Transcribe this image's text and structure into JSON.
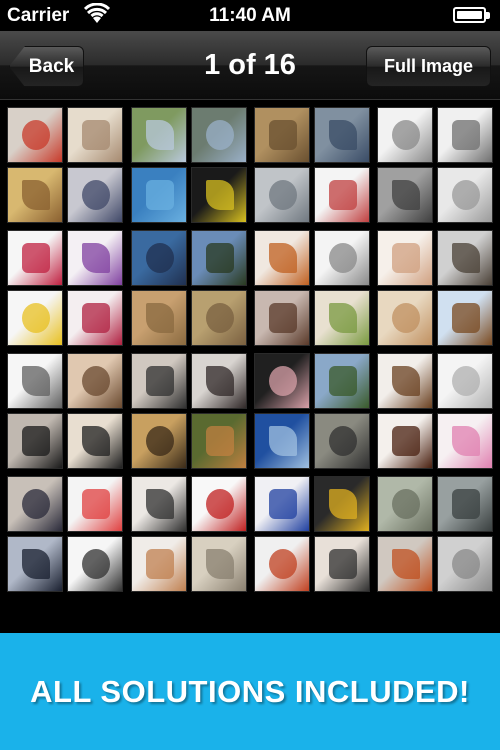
{
  "status_bar": {
    "carrier": "Carrier",
    "time": "11:40 AM",
    "wifi_icon": "wifi-icon",
    "battery_icon": "battery-icon",
    "battery_level": 1.0
  },
  "nav": {
    "back_label": "Back",
    "title": "1 of 16",
    "full_image_label": "Full Image"
  },
  "grid": {
    "description_icons": "image-thumbnail",
    "tiles": [
      {
        "color": "#d8d0c8",
        "accent": "#c83a2a",
        "icon": "face-paint-thumbnail"
      },
      {
        "color": "#e6dccc",
        "accent": "#a68a70",
        "icon": "baby-thumbnail"
      },
      {
        "color": "#7f9a60",
        "accent": "#b8c8dc",
        "icon": "field-thumbnail"
      },
      {
        "color": "#6c7c70",
        "accent": "#9ab0c8",
        "icon": "lake-thumbnail"
      },
      {
        "color": "#b09060",
        "accent": "#6a5030",
        "icon": "hamster-thumbnail"
      },
      {
        "color": "#8090a0",
        "accent": "#3a4c66",
        "icon": "usb-drive-thumbnail"
      },
      {
        "color": "#f2f2f2",
        "accent": "#8a8a8a",
        "icon": "sheet-music-thumbnail"
      },
      {
        "color": "#f0f0f0",
        "accent": "#707070",
        "icon": "key-thumbnail"
      },
      {
        "color": "#d8b870",
        "accent": "#8a6030",
        "icon": "pasta-thumbnail"
      },
      {
        "color": "#c8c8d0",
        "accent": "#404868",
        "icon": "fan-thumbnail"
      },
      {
        "color": "#3a80c0",
        "accent": "#6ab0e0",
        "icon": "pool-thumbnail"
      },
      {
        "color": "#1a1a1a",
        "accent": "#d8c020",
        "icon": "tools-thumbnail"
      },
      {
        "color": "#c0c4c8",
        "accent": "#707880",
        "icon": "mouse-thumbnail"
      },
      {
        "color": "#f4f4f4",
        "accent": "#c04040",
        "icon": "cartoon-mouse-thumbnail"
      },
      {
        "color": "#a0a0a0",
        "accent": "#404040",
        "icon": "keyboard-key-thumbnail"
      },
      {
        "color": "#e8e8e8",
        "accent": "#9a9a9a",
        "icon": "keyboard-thumbnail"
      },
      {
        "color": "#f6f6f6",
        "accent": "#c02040",
        "icon": "flower-letter-thumbnail"
      },
      {
        "color": "#f4f0f4",
        "accent": "#8040a0",
        "icon": "envelope-thumbnail"
      },
      {
        "color": "#3a6aa0",
        "accent": "#203050",
        "icon": "palm-tree-thumbnail"
      },
      {
        "color": "#6a8cb8",
        "accent": "#2a3a20",
        "icon": "palm-leaves-thumbnail"
      },
      {
        "color": "#f0e8e0",
        "accent": "#c06020",
        "icon": "food-plate-thumbnail"
      },
      {
        "color": "#f4f4f4",
        "accent": "#8a8a8a",
        "icon": "dish-antenna-thumbnail"
      },
      {
        "color": "#f6f0ea",
        "accent": "#d0a080",
        "icon": "handshake-thumbnail"
      },
      {
        "color": "#d0d0d0",
        "accent": "#4a4036",
        "icon": "dog-snow-thumbnail"
      },
      {
        "color": "#f6f6f6",
        "accent": "#e8c020",
        "icon": "shapes-thumbnail"
      },
      {
        "color": "#f4eef0",
        "accent": "#b02040",
        "icon": "heart-envelope-thumbnail"
      },
      {
        "color": "#c8a070",
        "accent": "#8a6a40",
        "icon": "texture-thumbnail"
      },
      {
        "color": "#b8a070",
        "accent": "#7a6040",
        "icon": "sand-thumbnail"
      },
      {
        "color": "#c8b8b0",
        "accent": "#5a3a2a",
        "icon": "woman-hands-thumbnail"
      },
      {
        "color": "#e8e0d0",
        "accent": "#7a9a40",
        "icon": "dinner-plate-thumbnail"
      },
      {
        "color": "#e8d8c0",
        "accent": "#c09060",
        "icon": "pie-thumbnail"
      },
      {
        "color": "#d0e0f0",
        "accent": "#7a4a20",
        "icon": "puppy-thumbnail"
      },
      {
        "color": "#f6f6f6",
        "accent": "#606060",
        "icon": "music-notes-thumbnail"
      },
      {
        "color": "#e0c8b0",
        "accent": "#6a4a30",
        "icon": "braille-thumbnail"
      },
      {
        "color": "#d0c8c0",
        "accent": "#303030",
        "icon": "sunglasses-woman-thumbnail"
      },
      {
        "color": "#d8d4d0",
        "accent": "#302828",
        "icon": "woman-portrait-thumbnail"
      },
      {
        "color": "#202020",
        "accent": "#d8a0a8",
        "icon": "piggy-bank-thumbnail"
      },
      {
        "color": "#8aa8c8",
        "accent": "#3a5a2a",
        "icon": "winter-trees-thumbnail"
      },
      {
        "color": "#f2eeea",
        "accent": "#6a4020",
        "icon": "stuffed-toy-thumbnail"
      },
      {
        "color": "#f4f4f4",
        "accent": "#b0b0b0",
        "icon": "bottle-thumbnail"
      },
      {
        "color": "#c0b8b0",
        "accent": "#1a1a1a",
        "icon": "headphones-person-thumbnail"
      },
      {
        "color": "#e8ded0",
        "accent": "#202020",
        "icon": "piano-hands-thumbnail"
      },
      {
        "color": "#c8a060",
        "accent": "#3a2a18",
        "icon": "leopard-print-thumbnail"
      },
      {
        "color": "#5a6a30",
        "accent": "#c08040",
        "icon": "cat-grass-thumbnail"
      },
      {
        "color": "#2050a0",
        "accent": "#a0c0e0",
        "icon": "card-thumbnail"
      },
      {
        "color": "#8a8a80",
        "accent": "#303030",
        "icon": "rocks-thumbnail"
      },
      {
        "color": "#f4f0ec",
        "accent": "#4a2010",
        "icon": "chocolate-thumbnail"
      },
      {
        "color": "#f6f0f2",
        "accent": "#e080b0",
        "icon": "pink-flower-thumbnail"
      },
      {
        "color": "#c8c0b8",
        "accent": "#2a2a3a",
        "icon": "businesswoman-thumbnail"
      },
      {
        "color": "#f4f4f4",
        "accent": "#e04040",
        "icon": "sale-tag-thumbnail"
      },
      {
        "color": "#ece8e4",
        "accent": "#303030",
        "icon": "woman-phone-thumbnail"
      },
      {
        "color": "#f8f8f8",
        "accent": "#c02020",
        "icon": "bar-chart-thumbnail"
      },
      {
        "color": "#f0f0f4",
        "accent": "#2040a0",
        "icon": "calendar-thumbnail"
      },
      {
        "color": "#2a2a2a",
        "accent": "#e0b020",
        "icon": "sunflower-thumbnail"
      },
      {
        "color": "#b0b8a8",
        "accent": "#6a7060",
        "icon": "lizard-thumbnail"
      },
      {
        "color": "#98a0a0",
        "accent": "#3a4040",
        "icon": "turtle-thumbnail"
      },
      {
        "color": "#b0b8c8",
        "accent": "#1a2030",
        "icon": "businessman-thumbnail"
      },
      {
        "color": "#f6f6f6",
        "accent": "#303030",
        "icon": "club-symbol-thumbnail"
      },
      {
        "color": "#f0ece8",
        "accent": "#c08050",
        "icon": "bread-thumbnail"
      },
      {
        "color": "#d8d0c0",
        "accent": "#8a8070",
        "icon": "calculator-thumbnail"
      },
      {
        "color": "#f0f0f0",
        "accent": "#c04020",
        "icon": "apple-papers-thumbnail"
      },
      {
        "color": "#e8e0d8",
        "accent": "#303030",
        "icon": "couple-thumbnail"
      },
      {
        "color": "#d0c8c0",
        "accent": "#c05020",
        "icon": "egg-thumbnail"
      },
      {
        "color": "#d0d0d0",
        "accent": "#8a8a8a",
        "icon": "gray-surface-thumbnail"
      }
    ]
  },
  "banner": {
    "text": "ALL SOLUTIONS INCLUDED!",
    "background": "#1ab2ea"
  }
}
